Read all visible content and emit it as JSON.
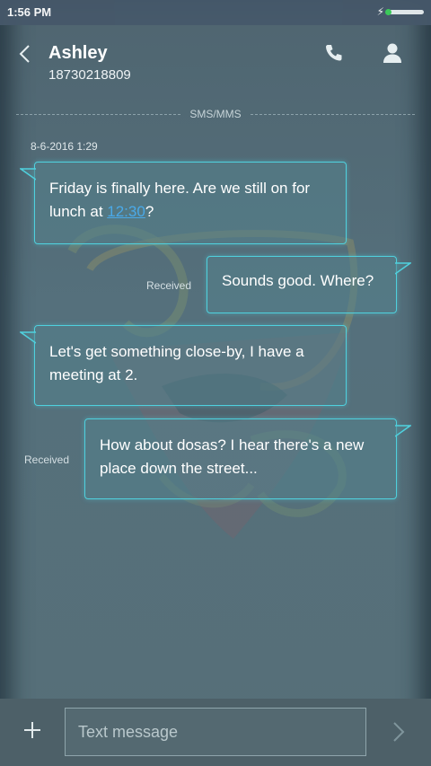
{
  "status_bar": {
    "time": "1:56 PM",
    "charge_icon": "lightning-icon",
    "battery_icon": "battery-icon"
  },
  "header": {
    "contact_name": "Ashley",
    "contact_number": "18730218809",
    "back_icon": "back-chevron-icon",
    "call_icon": "phone-icon",
    "profile_icon": "person-icon"
  },
  "conversation": {
    "channel_label": "SMS/MMS",
    "timestamp": "8-6-2016 1:29",
    "messages": [
      {
        "direction": "incoming",
        "text_before": "Friday is finally here. Are we still on for lunch at ",
        "link_text": "12:30",
        "text_after": "?"
      },
      {
        "direction": "outgoing",
        "status": "Received",
        "text": "Sounds good. Where?"
      },
      {
        "direction": "incoming",
        "text": "Let's get something close-by, I have a meeting at 2."
      },
      {
        "direction": "outgoing",
        "status": "Received",
        "text": "How about dosas? I hear there's a new place down the street..."
      }
    ]
  },
  "composer": {
    "placeholder": "Text message",
    "value": "",
    "add_icon": "plus-icon",
    "send_icon": "send-chevron-icon"
  },
  "colors": {
    "bubble_border": "#4fd1de",
    "link": "#4aa9e8",
    "background": "#55707c"
  }
}
